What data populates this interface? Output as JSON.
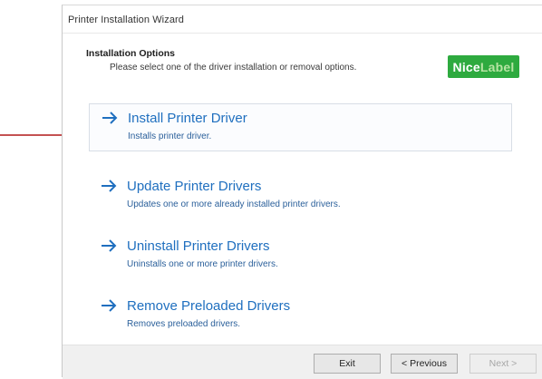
{
  "window": {
    "title": "Printer Installation Wizard"
  },
  "header": {
    "title": "Installation Options",
    "description": "Please select one of the driver installation or removal options."
  },
  "logo": {
    "part1": "Nice",
    "part2": "Label",
    "color": "#2eaa3f"
  },
  "options": [
    {
      "title": "Install Printer Driver",
      "description": "Installs printer driver.",
      "selected": true,
      "icon": "arrow-right-icon"
    },
    {
      "title": "Update Printer Drivers",
      "description": "Updates one or more already installed printer drivers.",
      "selected": false,
      "icon": "arrow-right-icon"
    },
    {
      "title": "Uninstall Printer Drivers",
      "description": "Uninstalls one or more printer drivers.",
      "selected": false,
      "icon": "arrow-right-icon"
    },
    {
      "title": "Remove Preloaded Drivers",
      "description": "Removes preloaded drivers.",
      "selected": false,
      "icon": "arrow-right-icon"
    }
  ],
  "footer": {
    "exit_label": "Exit",
    "previous_label": "< Previous",
    "next_label": "Next >"
  },
  "colors": {
    "link_blue": "#1f6fbf",
    "annotation_red": "#b01818"
  }
}
